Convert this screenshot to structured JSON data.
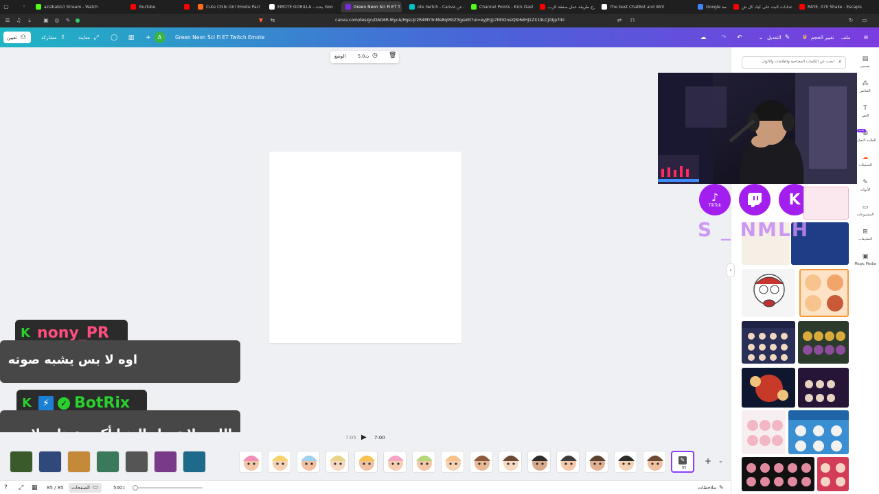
{
  "browser": {
    "tabs": [
      {
        "label": "azizbab10 Stream - Watch",
        "favicon_color": "#53fc18"
      },
      {
        "label": "YouTube",
        "favicon_color": "#ff0000"
      },
      {
        "label": "ج",
        "favicon_color": "#ff0000"
      },
      {
        "label": "Cute Chibi Girl Emote Pack",
        "favicon_color": "#ff6b1a"
      },
      {
        "label": "EMOTE GORILLA - بحث Goo",
        "favicon_color": "#ffffff"
      },
      {
        "label": "Green Neon Sci Fi ET T",
        "favicon_color": "#7d2ae8",
        "active": true
      },
      {
        "label": "ote twitch - Canva بحث عن",
        "favicon_color": "#00c4cc"
      },
      {
        "label": "Channel Points - Kick Dash",
        "favicon_color": "#53fc18"
      },
      {
        "label": "شرح طريقة عمل صفقة الرب",
        "favicon_color": "#ff0000"
      },
      {
        "label": "The best ChatBot and Writ",
        "favicon_color": "#ffffff"
      },
      {
        "label": "Google ترجمة",
        "favicon_color": "#4285f4"
      },
      {
        "label": "إعدادات البث على كيك كل ش",
        "favicon_color": "#ff0000"
      },
      {
        "label": "RAYE, 070 Shake - Escapis",
        "favicon_color": "#ff0000"
      }
    ],
    "url": "canva.com/design/DAG6R-l6ycA/HgsUjr2R4MY3nMe8qMGZ3g/edit?ui=eyJEIjp7IlEiOnsiQSI6dHJ1ZX19LCJGIjp7IkI"
  },
  "canva_bar": {
    "share_button": "تعيين",
    "share": "مشاركة",
    "preview": "معاينة",
    "avatar_letter": "A",
    "design_title": "Green Neon Sci Fi ET Twitch Emote",
    "edit": "التعديل",
    "resize": "تغيير الحجم",
    "file": "ملف"
  },
  "page_tools": {
    "position": "الوضع",
    "duration": "5.0ث"
  },
  "side_panel": {
    "search_placeholder": "ابحث عن الكلمات المفتاحية والعلامات والألوان"
  },
  "rail": [
    {
      "label": "تصميم",
      "icon": "layout-icon"
    },
    {
      "label": "العناصر",
      "icon": "elements-icon"
    },
    {
      "label": "النص",
      "icon": "text-icon"
    },
    {
      "label": "العلامة التجارية",
      "icon": "brand-icon",
      "badge": "جديد"
    },
    {
      "label": "التحميلات",
      "icon": "uploads-icon"
    },
    {
      "label": "الأدوات",
      "icon": "tools-icon"
    },
    {
      "label": "المشروعات",
      "icon": "projects-icon"
    },
    {
      "label": "التطبيقات",
      "icon": "apps-icon"
    },
    {
      "label": "Magic Media",
      "icon": "magic-media-icon"
    }
  ],
  "overlay": {
    "watermark": "S _ NMLH",
    "social_icons": [
      "TikTok",
      "twitch",
      "kick"
    ]
  },
  "chat": [
    {
      "user": "nony_PR",
      "message": "اوه لا بس يشبه صوته"
    },
    {
      "user": "BotRix",
      "message": "اللهم لا تجعل الدنيا أكبر همنا، ولا مبلغ علمنا"
    }
  ],
  "timeline": {
    "time_current": "7:05",
    "time_total": "7:00",
    "page_count": 85
  },
  "status": {
    "notes": "ملاحظات",
    "pages": "الصفحات",
    "page_position": "85 / 85",
    "zoom": "500٪"
  }
}
